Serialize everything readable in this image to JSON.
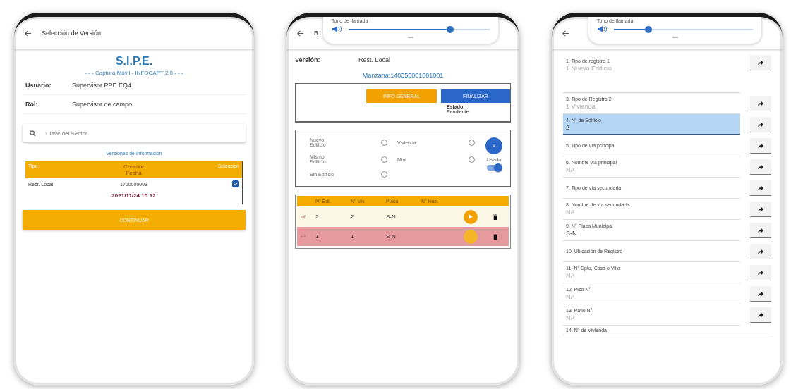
{
  "version_screen": {
    "title": "Selección de Versión",
    "app_name": "S.I.P.E.",
    "subtitle": "- - - Captura Móvil - INFOCAPT 2.0 - - -",
    "info": [
      {
        "label": "Usuario:",
        "value": "Supervisor PPE EQ4"
      },
      {
        "label": "Rol:",
        "value": "Supervisor de campo"
      }
    ],
    "search": {
      "placeholder": "Clave del Sector"
    },
    "section_title": "Versiones de Información",
    "table": {
      "columns": [
        "Tipo",
        "Creador",
        "Fecha",
        "Seleccion"
      ],
      "rows": [
        {
          "tipo": "Rest. Local",
          "creador": "1700000003",
          "fecha": "2021/11/24 15:12",
          "checked": true
        }
      ]
    },
    "button": "CONTINUAR"
  },
  "block_screen": {
    "title": "R",
    "volume": {
      "label": "Tono de llamada",
      "level": 0.72
    },
    "version_label": "Versión:",
    "version_value": "Rest. Local",
    "block": "Manzana:140350001001001",
    "buttons": [
      {
        "label": "INFO GENERAL",
        "kind": "secondary"
      },
      {
        "label": "FINALIZAR",
        "kind": "primary"
      }
    ],
    "status_label": "Estado:",
    "status_value": "Pendiente",
    "options": [
      {
        "label": "Nuevo Edificio",
        "selected": false
      },
      {
        "label": "Vivienda",
        "selected": false
      },
      {
        "label": "Mismo Edificio",
        "selected": false
      },
      {
        "label": "Mini",
        "selected": false
      },
      {
        "label": "Sin Edificio",
        "selected": false
      }
    ],
    "fab": "+",
    "toggle": {
      "label": "Usado",
      "on": true
    },
    "table": {
      "columns": [
        "N° Edi.",
        "N° Viv.",
        "Placa",
        "N° Hab."
      ],
      "rows": [
        {
          "edificio": "2",
          "vivienda": "2",
          "placa": "S-N",
          "highlighted": false
        },
        {
          "edificio": "1",
          "vivienda": "1",
          "placa": "S-N",
          "highlighted": true
        }
      ]
    }
  },
  "form_screen": {
    "volume": {
      "label": "Tono de llamada",
      "level": 0.25
    },
    "fields": [
      {
        "label": "1. Tipo de registro 1",
        "value": "1 Nuevo Edificio",
        "filled": false,
        "selected": false,
        "gap_after": true
      },
      {
        "label": "3. Tipo de Registro 2",
        "value": "1 Vivienda",
        "filled": false,
        "selected": false
      },
      {
        "label": "4. N° de Edificio",
        "value": "2",
        "filled": true,
        "selected": true
      },
      {
        "label": "5. Tipo de vía principal",
        "selected": false
      },
      {
        "label": "6. Nombre vía principal",
        "value": "NA",
        "filled": false,
        "selected": false
      },
      {
        "label": "7. Tipo de vía secundaria",
        "selected": false
      },
      {
        "label": "8. Nombre de vía secundaria",
        "value": "NA",
        "filled": false,
        "selected": false
      },
      {
        "label": "9. N° Placa Municipal",
        "value": "S-N",
        "filled": true,
        "selected": false
      },
      {
        "label": "10. Ubicación de Registro",
        "selected": false
      },
      {
        "label": "11. N° Dpto, Casa o Villa",
        "value": "NA",
        "filled": false,
        "selected": false
      },
      {
        "label": "12. Piso N°",
        "value": "NA",
        "filled": false,
        "selected": false
      },
      {
        "label": "13. Patio N°",
        "value": "NA",
        "filled": false,
        "selected": false
      },
      {
        "label": "14. N° de Vivienda",
        "selected": false,
        "cut": true
      }
    ]
  }
}
